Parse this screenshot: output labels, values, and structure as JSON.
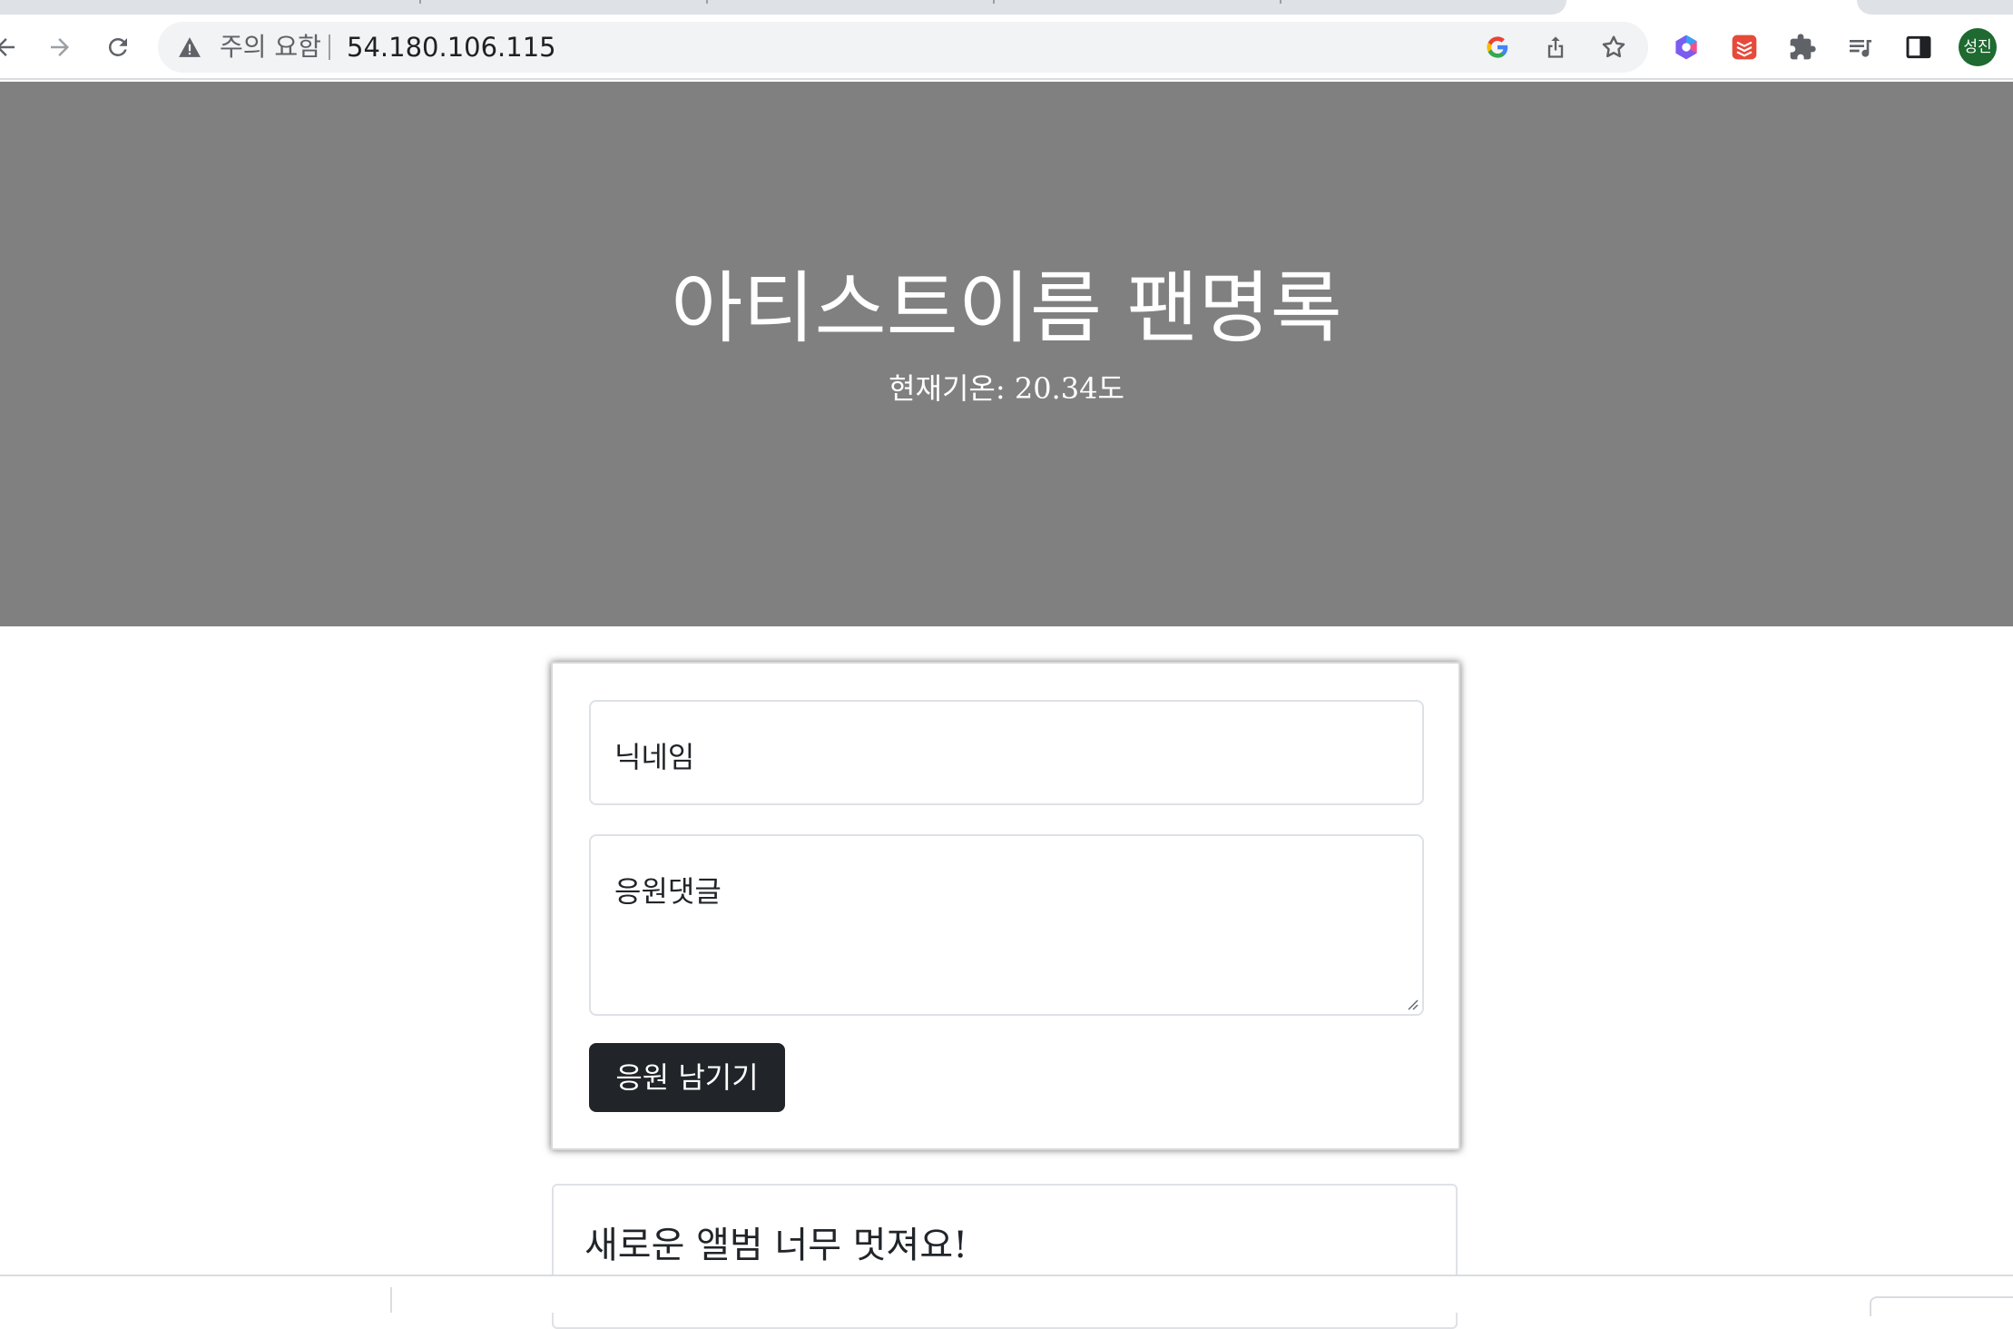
{
  "browser": {
    "address_bar": {
      "security_label": "주의 요함",
      "url": "54.180.106.115"
    },
    "profile": {
      "initials": "성진",
      "color": "#1e6a30"
    }
  },
  "page": {
    "hero": {
      "title": "아티스트이름 팬명록",
      "weather": {
        "label": "현재기온:",
        "value": "20.34",
        "unit": "도"
      },
      "background_color": "#808080"
    },
    "form": {
      "nickname_placeholder": "닉네임",
      "comment_placeholder": "응원댓글",
      "submit_label": "응원 남기기"
    },
    "comments": [
      {
        "text": "새로운 앨범 너무 멋져요!"
      }
    ]
  },
  "colors": {
    "button_dark": "#212529",
    "extension_red": "#e64a3b"
  }
}
